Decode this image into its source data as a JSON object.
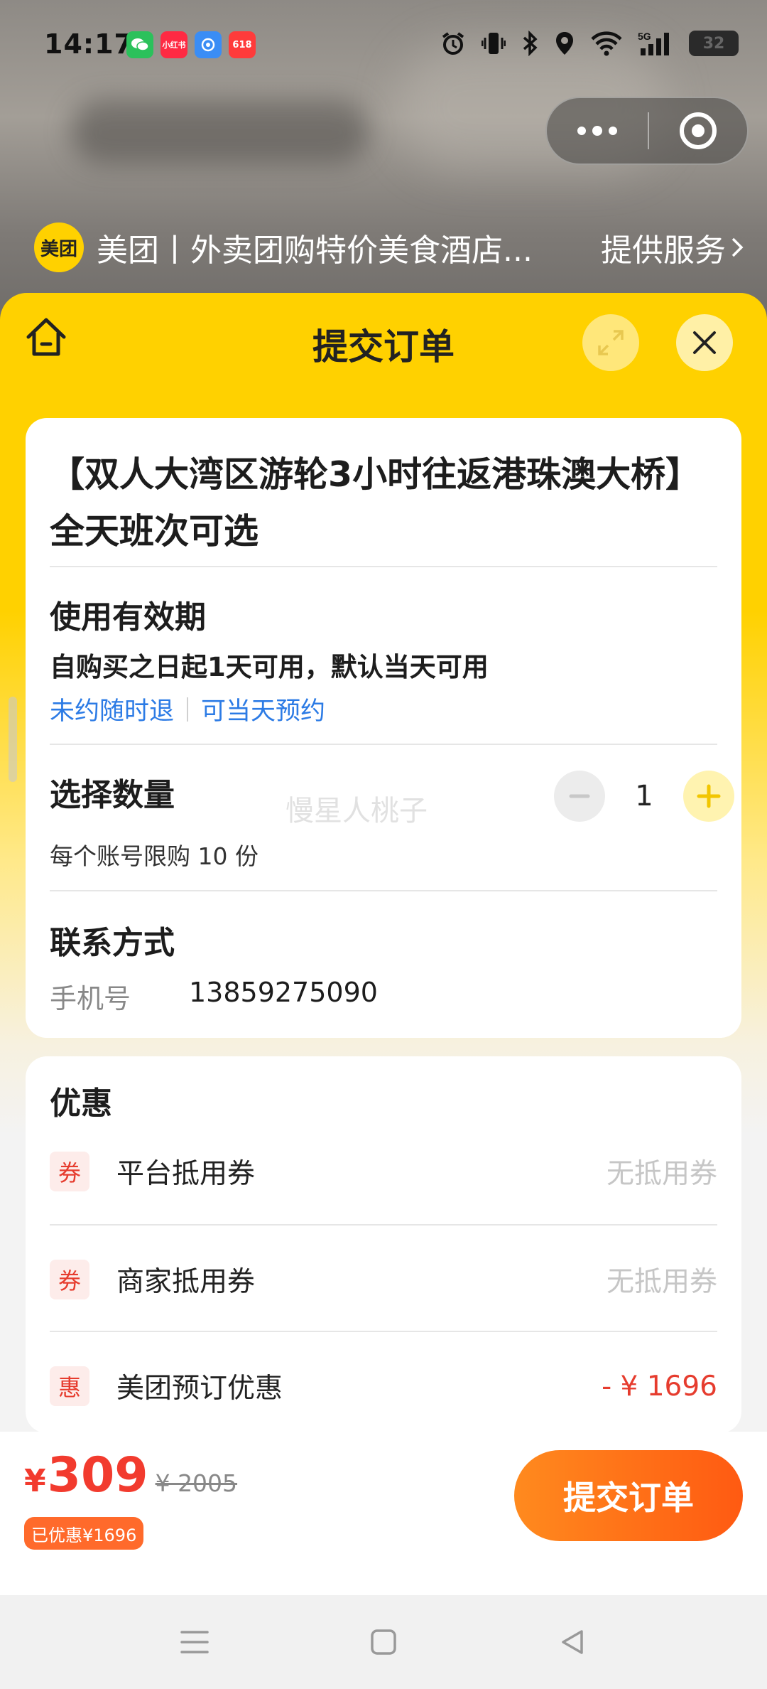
{
  "status_bar": {
    "time": "14:17",
    "apps": [
      {
        "name": "wechat",
        "color": "#2bc15b",
        "label": "",
        "icon": "wechat-icon"
      },
      {
        "name": "xiaohongshu",
        "color": "#ff2a43",
        "label": "小红书",
        "icon": "xiaohongshu-icon"
      },
      {
        "name": "app-blue",
        "color": "#3a8df5",
        "label": "",
        "icon": "blue-app-icon"
      },
      {
        "name": "app-618",
        "color": "#ff3b3b",
        "label": "618",
        "icon": "shopping-618-icon"
      }
    ],
    "battery": "32",
    "network": "5G"
  },
  "capsule": {
    "more": "more-icon",
    "close": "close-miniprogram-icon"
  },
  "service": {
    "logo_text": "美团",
    "title": "美团丨外卖团购特价美食酒店...",
    "link": "提供服务"
  },
  "sheet": {
    "title": "提交订单"
  },
  "order": {
    "product_title": "【双人大湾区游轮3小时往返港珠澳大桥】全天班次可选",
    "validity": {
      "title": "使用有效期",
      "text": "自购买之日起1天可用，默认当天可用",
      "tags": [
        "未约随时退",
        "可当天预约"
      ]
    },
    "quantity": {
      "title": "选择数量",
      "value": "1",
      "limit": "每个账号限购 10 份"
    },
    "contact": {
      "title": "联系方式",
      "phone_label": "手机号",
      "phone_value": "13859275090"
    },
    "watermark": "慢星人桃子"
  },
  "discounts": {
    "title": "优惠",
    "items": [
      {
        "badge": "券",
        "label": "平台抵用券",
        "value": "无抵用券"
      },
      {
        "badge": "券",
        "label": "商家抵用券",
        "value": "无抵用券"
      },
      {
        "badge": "惠",
        "label": "美团预订优惠",
        "value": "- ¥ 1696"
      }
    ]
  },
  "bottom": {
    "currency": "¥",
    "price": "309",
    "original_price": "¥ 2005",
    "saved": "已优惠¥1696",
    "submit": "提交订单"
  },
  "colors": {
    "brand_yellow": "#ffd100",
    "price_red": "#f23b2e",
    "link_blue": "#2c7be5",
    "button_orange": "#ff6a1e"
  }
}
